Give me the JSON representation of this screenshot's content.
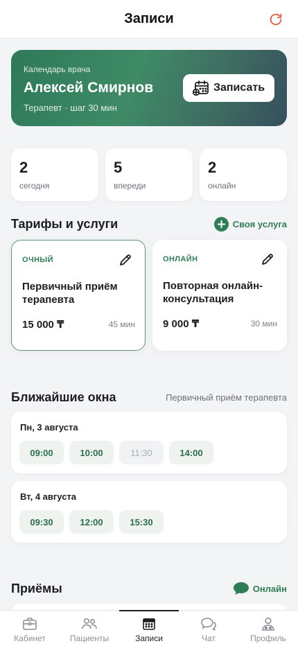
{
  "header": {
    "title": "Записи",
    "refresh_icon": "refresh-icon",
    "accent": "#e0573f"
  },
  "hero": {
    "subtitle": "Календарь врача",
    "name": "Алексей Смирнов",
    "meta": "Терапевт · шаг 30 мин",
    "button_label": "Записать",
    "button_icon": "calendar-add-icon"
  },
  "stats": [
    {
      "value": "2",
      "label": "сегодня"
    },
    {
      "value": "5",
      "label": "впереди"
    },
    {
      "value": "2",
      "label": "онлайн"
    }
  ],
  "tariffs_section": {
    "title": "Тарифы и услуги",
    "add_label": "Своя услуга",
    "items": [
      {
        "kind": "ОЧНЫЙ",
        "name": "Первичный приём терапевта",
        "price": "15 000 ₸",
        "duration": "45 мин",
        "selected": true
      },
      {
        "kind": "ОНЛАЙН",
        "name": "Повторная онлайн-консультация",
        "price": "9 000 ₸",
        "duration": "30 мин",
        "selected": false
      }
    ]
  },
  "slots_section": {
    "title": "Ближайшие окна",
    "service": "Первичный приём терапевта",
    "days": [
      {
        "title": "Пн, 3 августа",
        "slots": [
          {
            "time": "09:00",
            "available": true
          },
          {
            "time": "10:00",
            "available": true
          },
          {
            "time": "11:30",
            "available": false
          },
          {
            "time": "14:00",
            "available": true
          }
        ]
      },
      {
        "title": "Вт, 4 августа",
        "slots": [
          {
            "time": "09:30",
            "available": true
          },
          {
            "time": "12:00",
            "available": true
          },
          {
            "time": "15:30",
            "available": true
          }
        ]
      }
    ]
  },
  "appointments_section": {
    "title": "Приёмы",
    "filter_label": "Онлайн",
    "filter_icon": "chat-bubble-icon"
  },
  "tabbar": {
    "active": "Записи",
    "items": [
      {
        "label": "Кабинет",
        "icon": "briefcase-icon"
      },
      {
        "label": "Пациенты",
        "icon": "people-icon"
      },
      {
        "label": "Записи",
        "icon": "calendar-icon"
      },
      {
        "label": "Чат",
        "icon": "chat-icon"
      },
      {
        "label": "Профиль",
        "icon": "profile-icon"
      }
    ]
  },
  "colors": {
    "green": "#2f7d55",
    "text": "#1a1d21",
    "muted": "#6b7079",
    "background": "#f3f4f6"
  }
}
